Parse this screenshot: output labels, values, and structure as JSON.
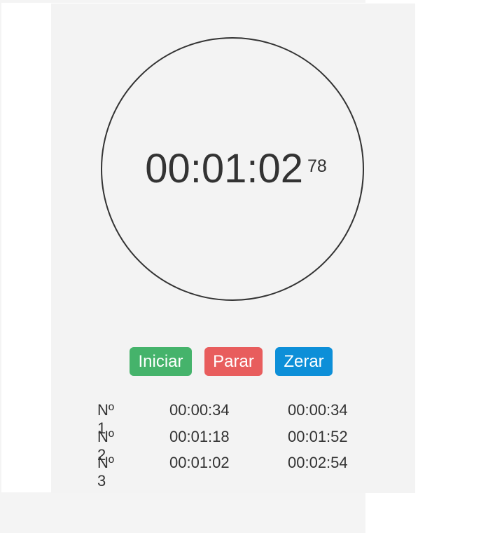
{
  "stopwatch": {
    "time": "00:01:02",
    "hundredths": "78"
  },
  "controls": {
    "start_label": "Iniciar",
    "stop_label": "Parar",
    "reset_label": "Zerar",
    "start_color": "#45b36b",
    "stop_color": "#e85d5d",
    "reset_color": "#0d8fd8"
  },
  "laps": [
    {
      "number": "Nº 1",
      "split": "00:00:34",
      "total": "00:00:34"
    },
    {
      "number": "Nº 2",
      "split": "00:01:18",
      "total": "00:01:52"
    },
    {
      "number": "Nº 3",
      "split": "00:01:02",
      "total": "00:02:54"
    }
  ]
}
